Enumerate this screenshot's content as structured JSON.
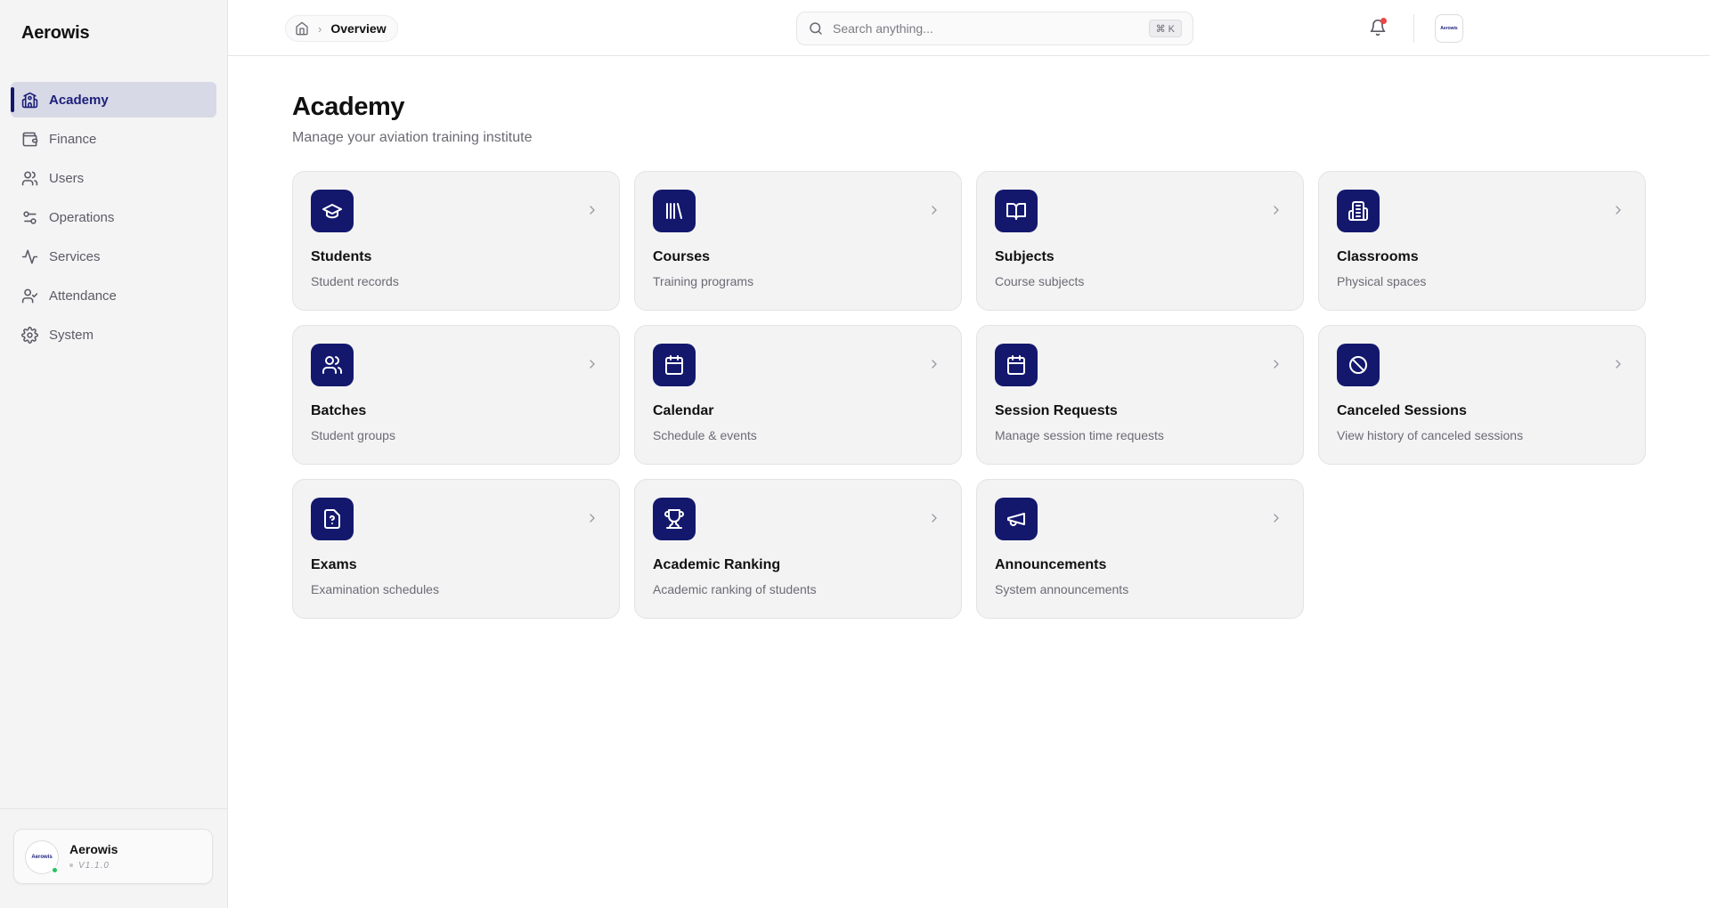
{
  "sidebar": {
    "brand": "Aerowis",
    "items": [
      {
        "label": "Academy",
        "icon": "academy-icon",
        "active": true
      },
      {
        "label": "Finance",
        "icon": "wallet-icon"
      },
      {
        "label": "Users",
        "icon": "users-icon"
      },
      {
        "label": "Operations",
        "icon": "sliders-icon"
      },
      {
        "label": "Services",
        "icon": "activity-icon"
      },
      {
        "label": "Attendance",
        "icon": "user-check-icon"
      },
      {
        "label": "System",
        "icon": "gear-icon"
      }
    ],
    "profile": {
      "name": "Aerowis",
      "version": "V1.1.0",
      "avatar_text": "Aerowis",
      "status_color": "#22c55e"
    }
  },
  "header": {
    "breadcrumb": {
      "home_icon": "home-icon",
      "current": "Overview"
    },
    "search": {
      "placeholder": "Search anything...",
      "shortcut": "⌘ K"
    },
    "avatar_text": "Aerowis",
    "notification_dot_color": "#ef4444"
  },
  "main": {
    "title": "Academy",
    "subtitle": "Manage your aviation training institute",
    "cards": [
      {
        "title": "Students",
        "desc": "Student records",
        "icon": "graduation-cap-icon"
      },
      {
        "title": "Courses",
        "desc": "Training programs",
        "icon": "library-icon"
      },
      {
        "title": "Subjects",
        "desc": "Course subjects",
        "icon": "book-open-icon"
      },
      {
        "title": "Classrooms",
        "desc": "Physical spaces",
        "icon": "building-icon"
      },
      {
        "title": "Batches",
        "desc": "Student groups",
        "icon": "users-icon"
      },
      {
        "title": "Calendar",
        "desc": "Schedule & events",
        "icon": "calendar-icon"
      },
      {
        "title": "Session Requests",
        "desc": "Manage session time requests",
        "icon": "calendar-icon"
      },
      {
        "title": "Canceled Sessions",
        "desc": "View history of canceled sessions",
        "icon": "ban-icon"
      },
      {
        "title": "Exams",
        "desc": "Examination schedules",
        "icon": "file-question-icon"
      },
      {
        "title": "Academic Ranking",
        "desc": "Academic ranking of students",
        "icon": "trophy-icon"
      },
      {
        "title": "Announcements",
        "desc": "System announcements",
        "icon": "megaphone-icon"
      }
    ]
  },
  "colors": {
    "accent": "#13186d",
    "active_bg": "#d8d9e6",
    "card_bg": "#f3f3f4",
    "sidebar_bg": "#f4f4f5"
  }
}
